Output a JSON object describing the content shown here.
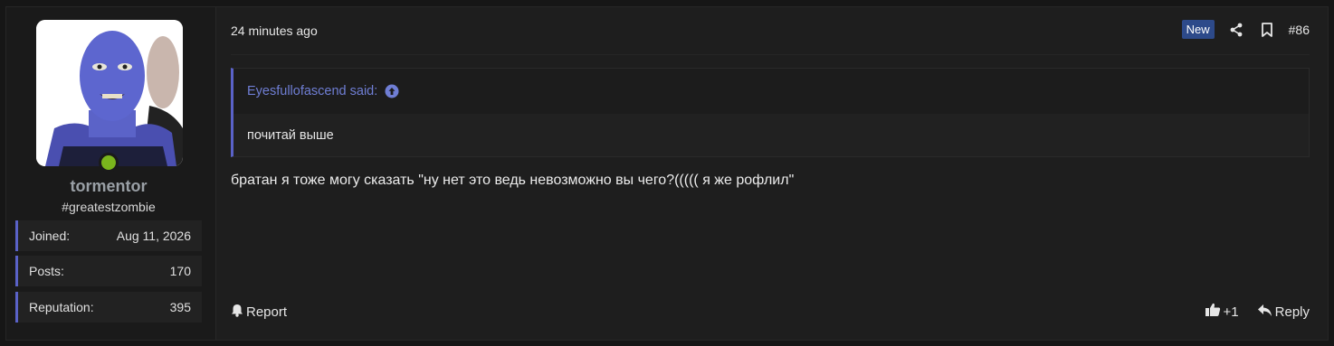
{
  "user": {
    "username": "tormentor",
    "title": "#greatestzombie",
    "stats": [
      {
        "label": "Joined:",
        "value": "Aug 11, 2026"
      },
      {
        "label": "Posts:",
        "value": "170"
      },
      {
        "label": "Reputation:",
        "value": "395"
      }
    ]
  },
  "post": {
    "timestamp": "24 minutes ago",
    "new_badge": "New",
    "post_number": "#86",
    "quote": {
      "author": "Eyesfullofascend said:",
      "text": "почитай выше"
    },
    "message": "братан я тоже могу сказать \"ну нет это ведь невозможно вы чего?((((( я же рофлил\"",
    "report_label": "Report",
    "like_count": "+1",
    "reply_label": "Reply"
  },
  "colors": {
    "accent": "#5a62c8",
    "quote_link": "#6f7ed4",
    "online": "#7ab51d",
    "new_badge": "#2d4a8a"
  }
}
